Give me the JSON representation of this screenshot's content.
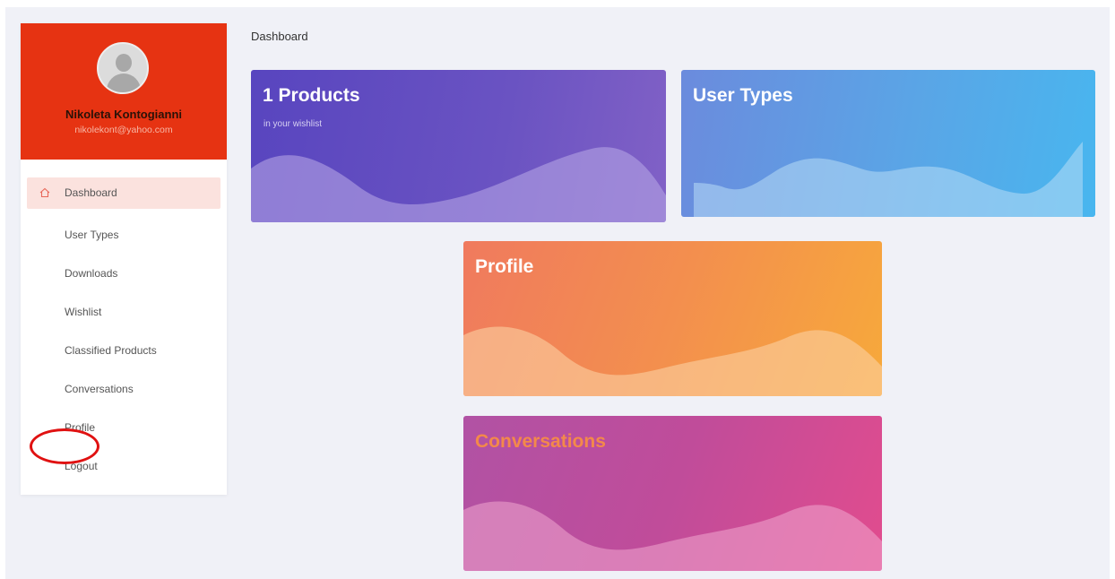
{
  "sidebar": {
    "user_name": "Nikoleta Kontogianni",
    "user_email": "nikolekont@yahoo.com",
    "nav_items": [
      {
        "label": "Dashboard",
        "icon": "home-icon",
        "active": true
      },
      {
        "label": "User Types"
      },
      {
        "label": "Downloads"
      },
      {
        "label": "Wishlist"
      },
      {
        "label": "Classified Products"
      },
      {
        "label": "Conversations"
      },
      {
        "label": "Profile"
      },
      {
        "label": "Logout",
        "annotation": "red-circle"
      }
    ]
  },
  "main": {
    "page_title": "Dashboard",
    "cards": [
      {
        "title": "1 Products",
        "subtitle": "in your wishlist"
      },
      {
        "title": "User Types"
      },
      {
        "title": "Profile"
      },
      {
        "title": "Conversations"
      }
    ]
  },
  "colors": {
    "profile_header": "#e63312",
    "active_nav_bg": "#fbe2de",
    "annotation_circle": "#e01111"
  }
}
